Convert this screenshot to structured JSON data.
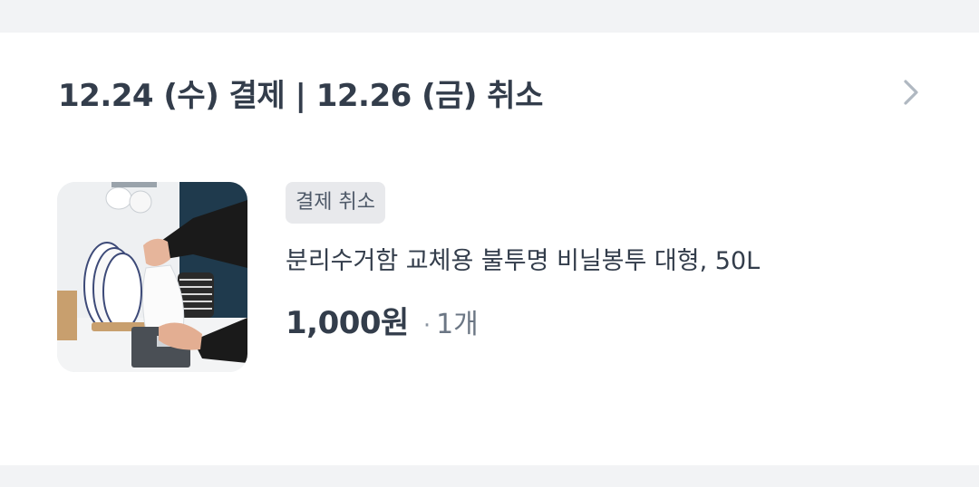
{
  "order": {
    "header_title": "12.24 (수) 결제 | 12.26 (금) 취소",
    "chevron_icon": "chevron-right-icon"
  },
  "item": {
    "status_badge": "결제 취소",
    "name": "분리수거함 교체용 불투명 비닐봉투 대형, 50L",
    "price": "1,000원",
    "separator": "·",
    "quantity": "1개",
    "image_alt": "비닐봉투를 꺼내는 손 사진"
  },
  "colors": {
    "background": "#f2f3f5",
    "card": "#ffffff",
    "text_primary": "#333d4b",
    "text_secondary": "#6b7684",
    "badge_bg": "#e8e9ec"
  }
}
